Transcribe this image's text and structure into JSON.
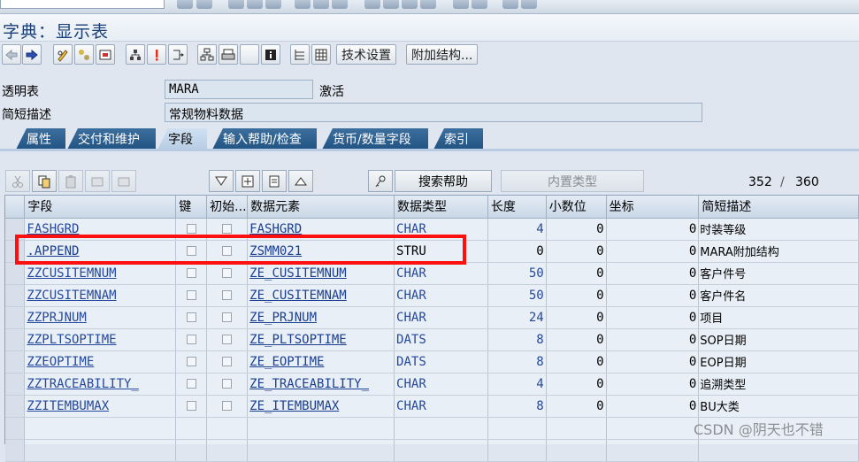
{
  "title": "字典：显示表",
  "toolbar": {
    "btn_tech_settings": "技术设置",
    "btn_append_structure": "附加结构..."
  },
  "header": {
    "transparent_table_label": "透明表",
    "table_name": "MARA",
    "status": "激活",
    "short_desc_label": "简短描述",
    "short_desc": "常规物料数据"
  },
  "tabs": [
    "属性",
    "交付和维护",
    "字段",
    "输入帮助/检查",
    "货币/数量字段",
    "索引"
  ],
  "active_tab": "字段",
  "table_toolbar": {
    "search_help": "搜索帮助",
    "builtin_type": "内置类型",
    "counter_current": "352",
    "counter_sep": "/",
    "counter_total": "360"
  },
  "columns": [
    "字段",
    "键",
    "初始...",
    "数据元素",
    "数据类型",
    "长度",
    "小数位",
    "坐标",
    "简短描述"
  ],
  "rows": [
    {
      "field": "FASHGRD",
      "element": "FASHGRD",
      "type": "CHAR",
      "length": "4",
      "decimals": "0",
      "coord": "0",
      "desc": "时装等级"
    },
    {
      "field": ".APPEND",
      "element": "ZSMM021",
      "type": "STRU",
      "length": "0",
      "decimals": "0",
      "coord": "0",
      "desc": "MARA附加结构"
    },
    {
      "field": "ZZCUSITEMNUM",
      "element": "ZE_CUSITEMNUM",
      "type": "CHAR",
      "length": "50",
      "decimals": "0",
      "coord": "0",
      "desc": "客户件号"
    },
    {
      "field": "ZZCUSITEMNAM",
      "element": "ZE_CUSITEMNAM",
      "type": "CHAR",
      "length": "50",
      "decimals": "0",
      "coord": "0",
      "desc": "客户件名"
    },
    {
      "field": "ZZPRJNUM",
      "element": "ZE_PRJNUM",
      "type": "CHAR",
      "length": "24",
      "decimals": "0",
      "coord": "0",
      "desc": "项目"
    },
    {
      "field": "ZZPLTSOPTIME",
      "element": "ZE_PLTSOPTIME",
      "type": "DATS",
      "length": "8",
      "decimals": "0",
      "coord": "0",
      "desc": "SOP日期"
    },
    {
      "field": "ZZEOPTIME",
      "element": "ZE_EOPTIME",
      "type": "DATS",
      "length": "8",
      "decimals": "0",
      "coord": "0",
      "desc": "EOP日期"
    },
    {
      "field": "ZZTRACEABILITY_",
      "element": "ZE_TRACEABILITY_",
      "type": "CHAR",
      "length": "4",
      "decimals": "0",
      "coord": "0",
      "desc": "追溯类型"
    },
    {
      "field": "ZZITEMBUMAX",
      "element": "ZE_ITEMBUMAX",
      "type": "CHAR",
      "length": "8",
      "decimals": "0",
      "coord": "0",
      "desc": "BU大类"
    }
  ],
  "watermark": "CSDN @阴天也不错",
  "colors": {
    "highlight": "#ff1010",
    "tab_bg": "#2a5c8c",
    "link": "#1a3e8f"
  }
}
